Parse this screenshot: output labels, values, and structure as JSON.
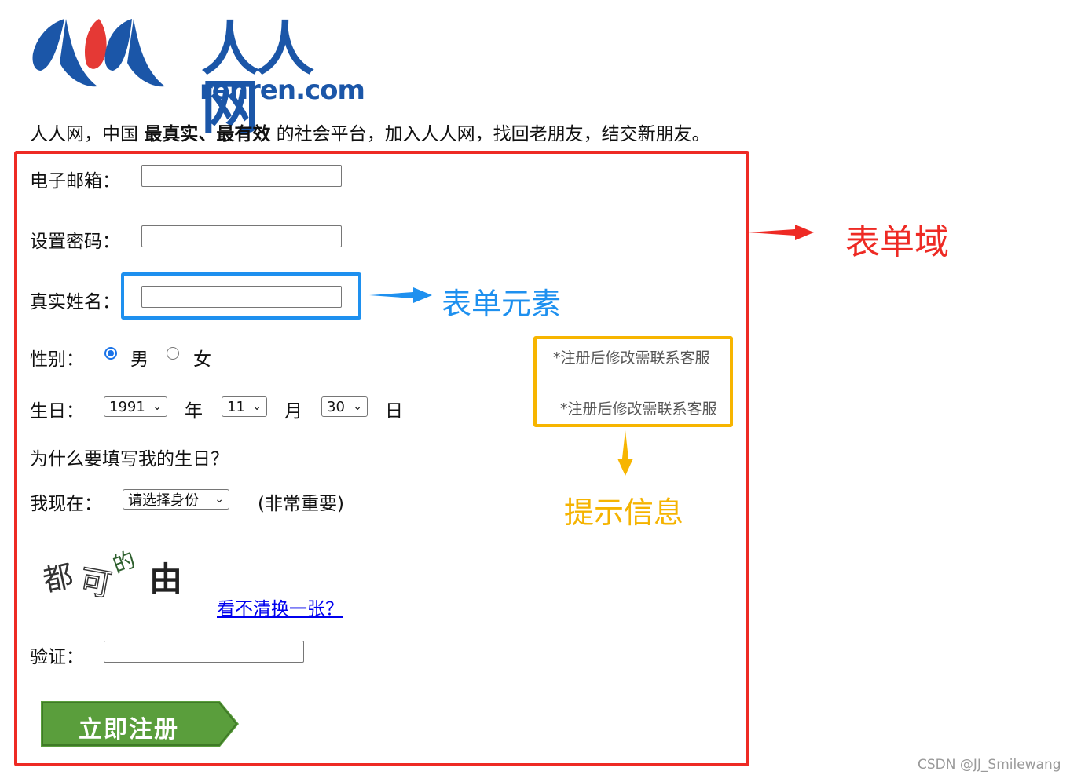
{
  "logo": {
    "cn": "人人网",
    "en": "renren.com"
  },
  "intro": {
    "part1": "人人网，中国",
    "bold": "最真实、最有效",
    "part2": "的社会平台，加入人人网，找回老朋友，结交新朋友。"
  },
  "form": {
    "email_label": "电子邮箱：",
    "password_label": "设置密码：",
    "realname_label": "真实姓名：",
    "gender_label": "性别：",
    "gender_male": "男",
    "gender_female": "女",
    "birthday_label": "生日：",
    "year_value": "1991",
    "year_unit": "年",
    "month_value": "11",
    "month_unit": "月",
    "day_value": "30",
    "day_unit": "日",
    "why_birthday": "为什么要填写我的生日？",
    "status_label": "我现在：",
    "status_value": "请选择身份",
    "status_note": "(非常重要)",
    "captcha_text": "都可的由",
    "captcha_refresh": "看不清换一张？",
    "verify_label": "验证：",
    "submit_label": "立即注册"
  },
  "hints": {
    "line1": "*注册后修改需联系客服",
    "line2": "*注册后修改需联系客服"
  },
  "annotations": {
    "form_domain": "表单域",
    "form_element": "表单元素",
    "hint_info": "提示信息"
  },
  "watermark": "CSDN @JJ_Smilewang",
  "colors": {
    "annotation_red": "#ee2a24",
    "annotation_blue": "#1e90ef",
    "annotation_yellow": "#f7b500",
    "brand_blue": "#1b56a8",
    "button_green": "#5a9e3c"
  }
}
